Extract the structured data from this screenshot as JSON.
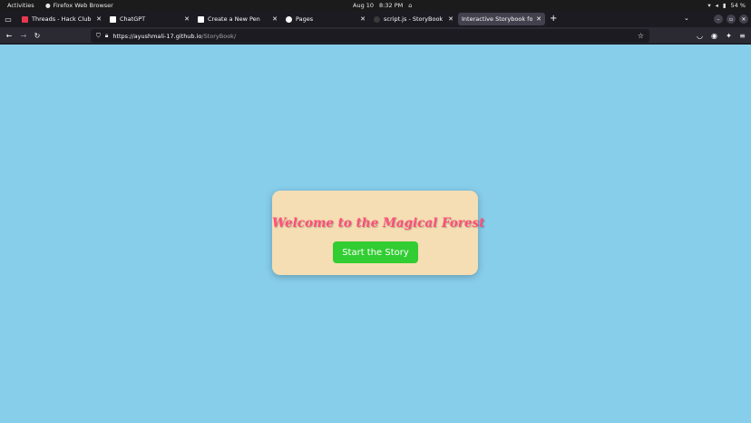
{
  "system_bar": {
    "activities": "Activities",
    "app_name": "Firefox Web Browser",
    "date": "Aug 10",
    "time": "8:32 PM",
    "battery": "54 %"
  },
  "tabs": [
    {
      "label": "Threads - Hack Club - Slac",
      "favicon_color": "#e8384f",
      "active": false
    },
    {
      "label": "ChatGPT",
      "favicon_color": "#ffffff",
      "active": false
    },
    {
      "label": "Create a New Pen",
      "favicon_color": "#ffffff",
      "active": false
    },
    {
      "label": "Pages",
      "favicon_color": "#ffffff",
      "active": false
    },
    {
      "label": "script.js - StoryBook [Cod",
      "favicon_color": "#3a3a3a",
      "active": false
    },
    {
      "label": "Interactive Storybook for Ki",
      "favicon_color": "#42414d",
      "active": true
    }
  ],
  "url": {
    "host": "https://ayushmali-17.github.io",
    "path": "/StoryBook/"
  },
  "page": {
    "background": "#87ceeb",
    "card_background": "#f5deb3",
    "title": "Welcome to the Magical Forest",
    "title_color": "#ff4f7b",
    "start_button": "Start the Story",
    "button_color": "#32cd32"
  }
}
